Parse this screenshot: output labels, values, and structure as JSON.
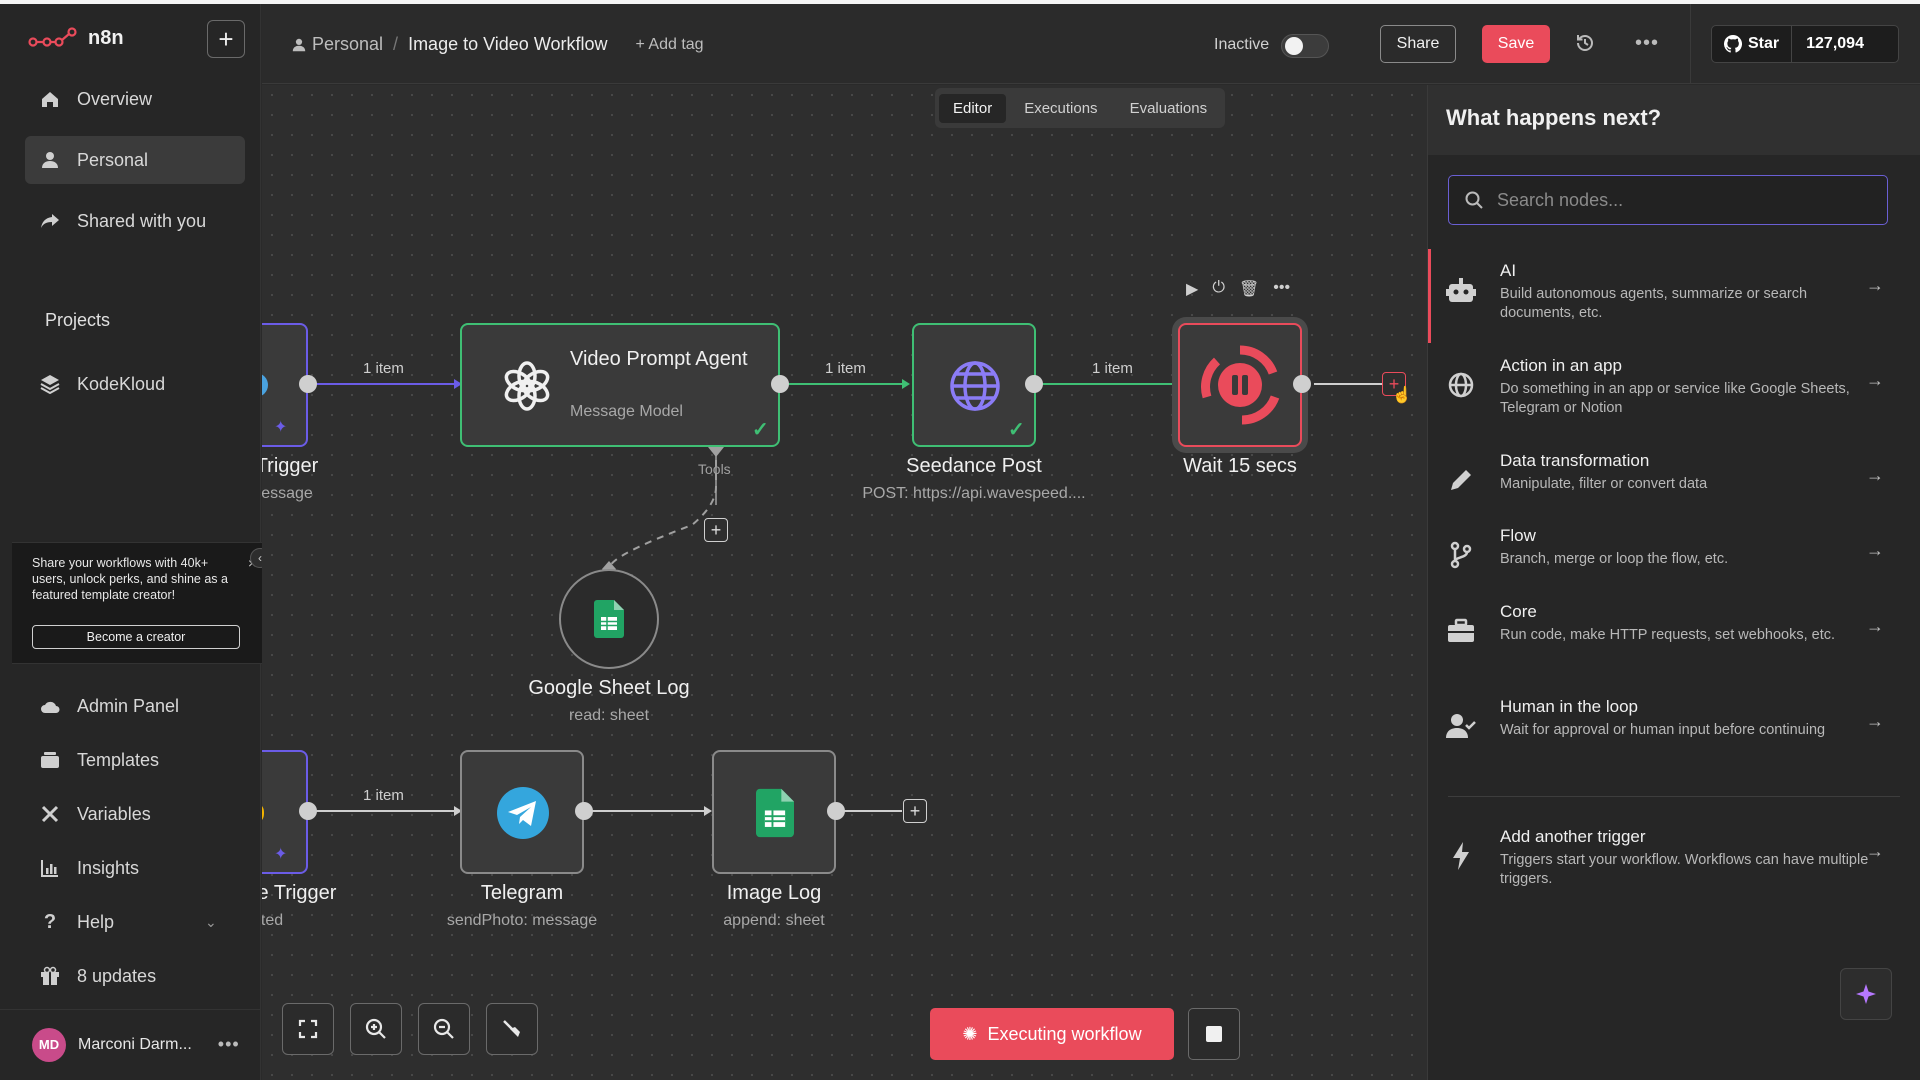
{
  "app": {
    "name": "n8n"
  },
  "sidebar": {
    "items_top": [
      {
        "label": "Overview",
        "icon": "home-icon"
      },
      {
        "label": "Personal",
        "icon": "user-icon",
        "active": true
      },
      {
        "label": "Shared with you",
        "icon": "share-icon"
      }
    ],
    "projects_label": "Projects",
    "projects": [
      {
        "label": "KodeKloud",
        "icon": "layers-icon"
      }
    ],
    "promo": {
      "text": "Share your workflows with 40k+ users, unlock perks, and shine as a featured template creator!",
      "button": "Become a creator",
      "close": "×"
    },
    "items_bottom": [
      {
        "label": "Admin Panel",
        "icon": "cloud-icon"
      },
      {
        "label": "Templates",
        "icon": "box-icon"
      },
      {
        "label": "Variables",
        "icon": "variable-icon"
      },
      {
        "label": "Insights",
        "icon": "chart-icon"
      },
      {
        "label": "Help",
        "icon": "help-icon"
      },
      {
        "label": "8 updates",
        "icon": "gift-icon"
      }
    ],
    "user": {
      "initials": "MD",
      "name": "Marconi Darm...",
      "more": "•••"
    }
  },
  "header": {
    "breadcrumb_project": "Personal",
    "breadcrumb_sep": "/",
    "workflow_name": "Image to Video Workflow",
    "add_tag": "+ Add tag",
    "active_label": "Inactive",
    "share": "Share",
    "save": "Save",
    "more": "•••",
    "github_star": "Star",
    "github_count": "127,094"
  },
  "tabs": [
    "Editor",
    "Executions",
    "Evaluations"
  ],
  "canvas": {
    "nodes": [
      {
        "id": "trigger-1",
        "title": "Trigger",
        "sub": "essage"
      },
      {
        "id": "video-prompt",
        "title": "Video Prompt Agent",
        "sub": "Message Model",
        "status": "success"
      },
      {
        "id": "seedance",
        "title": "Seedance Post",
        "sub": "POST: https://api.wavespeed....",
        "status": "success"
      },
      {
        "id": "wait",
        "title": "Wait 15 secs",
        "status": "running"
      },
      {
        "id": "sheet-log",
        "title": "Google Sheet Log",
        "sub": "read: sheet"
      },
      {
        "id": "trigger-2",
        "title": "e Trigger",
        "sub": "ted"
      },
      {
        "id": "telegram",
        "title": "Telegram",
        "sub": "sendPhoto: message"
      },
      {
        "id": "image-log",
        "title": "Image Log",
        "sub": "append: sheet"
      }
    ],
    "connection_labels": [
      "1 item",
      "1 item",
      "1 item",
      "1 item"
    ],
    "tools_label": "Tools",
    "executing": "Executing workflow"
  },
  "panel": {
    "title": "What happens next?",
    "search_placeholder": "Search nodes...",
    "categories": [
      {
        "title": "AI",
        "desc": "Build autonomous agents, summarize or search documents, etc.",
        "icon": "robot-icon"
      },
      {
        "title": "Action in an app",
        "desc": "Do something in an app or service like Google Sheets, Telegram or Notion",
        "icon": "globe-icon"
      },
      {
        "title": "Data transformation",
        "desc": "Manipulate, filter or convert data",
        "icon": "pen-icon"
      },
      {
        "title": "Flow",
        "desc": "Branch, merge or loop the flow, etc.",
        "icon": "branch-icon"
      },
      {
        "title": "Core",
        "desc": "Run code, make HTTP requests, set webhooks, etc.",
        "icon": "toolbox-icon"
      },
      {
        "title": "Human in the loop",
        "desc": "Wait for approval or human input before continuing",
        "icon": "user-check-icon"
      }
    ],
    "trigger": {
      "title": "Add another trigger",
      "desc": "Triggers start your workflow. Workflows can have multiple triggers.",
      "icon": "bolt-icon"
    }
  },
  "colors": {
    "accent": "#ea4b5b",
    "success": "#3fbf74",
    "primary": "#6b5ce7"
  }
}
